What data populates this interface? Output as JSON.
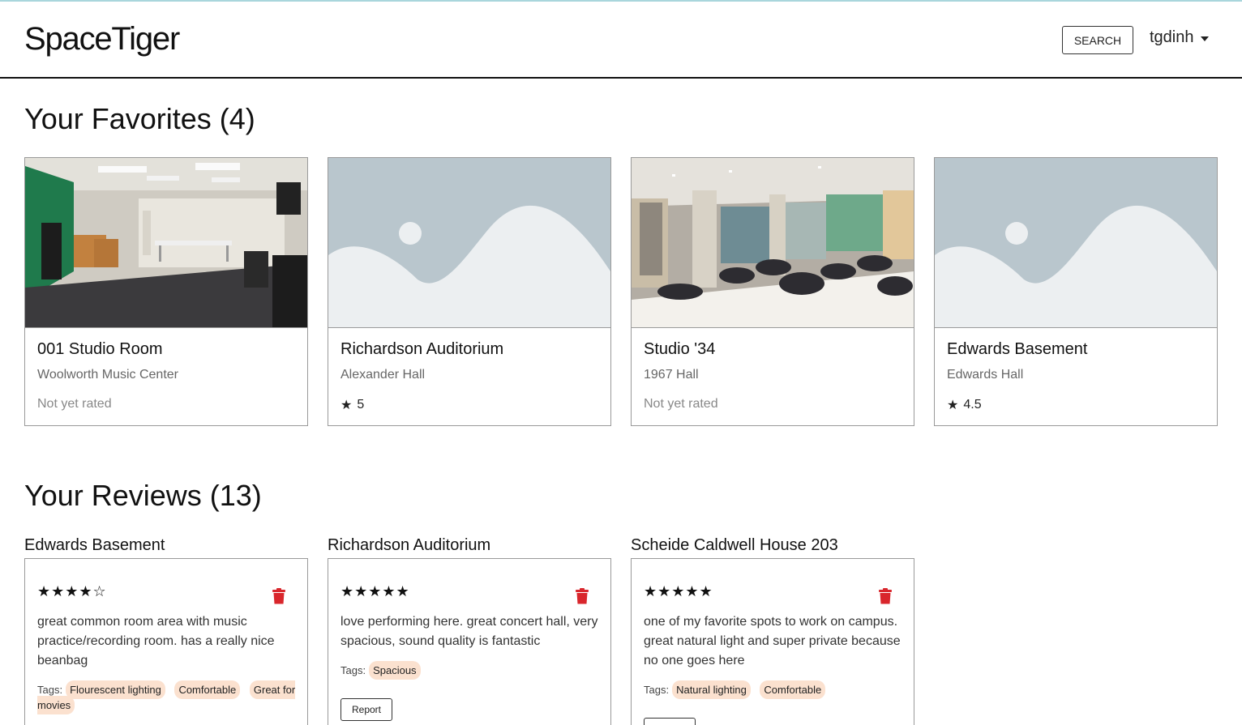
{
  "app": {
    "brand": "SpaceTiger",
    "search_label": "SEARCH",
    "username": "tgdinh"
  },
  "favorites": {
    "heading": "Your Favorites (4)",
    "items": [
      {
        "title": "001 Studio Room",
        "building": "Woolworth Music Center",
        "rating": "Not yet rated",
        "has_photo": true
      },
      {
        "title": "Richardson Auditorium",
        "building": "Alexander Hall",
        "rating": "5",
        "has_photo": false
      },
      {
        "title": "Studio '34",
        "building": "1967 Hall",
        "rating": "Not yet rated",
        "has_photo": true
      },
      {
        "title": "Edwards Basement",
        "building": "Edwards Hall",
        "rating": "4.5",
        "has_photo": false
      }
    ]
  },
  "reviews": {
    "heading": "Your Reviews (13)",
    "tags_label": "Tags:",
    "report_label": "Report",
    "items": [
      {
        "space": "Edwards Basement",
        "stars": "★★★★☆",
        "text": "great common room area with music practice/recording room. has a really nice beanbag",
        "tags": [
          "Flourescent lighting",
          "Comfortable",
          "Great for movies"
        ]
      },
      {
        "space": "Richardson Auditorium",
        "stars": "★★★★★",
        "text": "love performing here. great concert hall, very spacious, sound quality is fantastic",
        "tags": [
          "Spacious"
        ]
      },
      {
        "space": "Scheide Caldwell House 203",
        "stars": "★★★★★",
        "text": "one of my favorite spots to work on campus. great natural light and super private because no one goes here",
        "tags": [
          "Natural lighting",
          "Comfortable"
        ]
      }
    ]
  },
  "colors": {
    "accent_tag": "#fbe1cf",
    "trash": "#d9262c",
    "placeholder_bg": "#b9c6cd"
  },
  "icons": {
    "star": "star-icon",
    "trash": "trash-icon",
    "caret": "chevron-down-icon"
  }
}
